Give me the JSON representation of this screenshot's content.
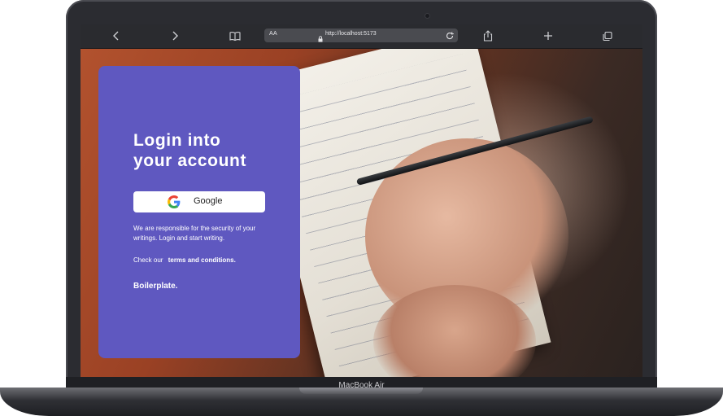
{
  "browser": {
    "text_size_label": "AA",
    "url": "http://localhost:5173"
  },
  "login": {
    "title_line1": "Login into",
    "title_line2": "your account",
    "google_button_label": "Google",
    "description": "We are responsible for the security of your writings. Login and start writing.",
    "terms_prefix": "Check our",
    "terms_link": "terms and conditions.",
    "brand": "Boilerplate."
  },
  "device": {
    "model_label": "MacBook Air"
  },
  "colors": {
    "card_background": "#5f58c0",
    "button_background": "#ffffff",
    "toolbar_background": "#2a2b2f"
  },
  "icons": {
    "back": "chevron-left-icon",
    "forward": "chevron-right-icon",
    "bookmarks": "book-icon",
    "lock": "lock-icon",
    "reload": "reload-icon",
    "share": "share-icon",
    "new_tab": "plus-icon",
    "tabs": "tabs-icon",
    "google": "google-icon"
  }
}
